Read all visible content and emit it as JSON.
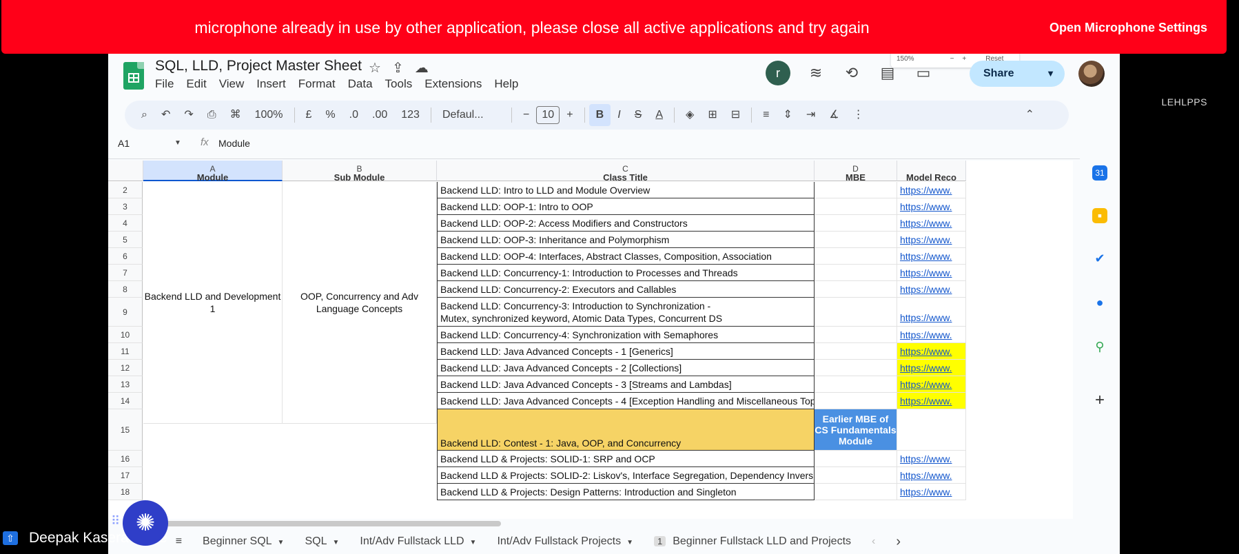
{
  "alert": {
    "message": "microphone already in use by other application, please close all active applications and try again",
    "action": "Open Microphone Settings"
  },
  "right_label": "LEHLPPS",
  "doc": {
    "title": "SQL, LLD, Project Master Sheet",
    "menu": [
      "File",
      "Edit",
      "View",
      "Insert",
      "Format",
      "Data",
      "Tools",
      "Extensions",
      "Help"
    ],
    "share": "Share",
    "user_initial": "r"
  },
  "zoom_popup": {
    "level": "150%",
    "minus": "−",
    "plus": "+",
    "reset": "Reset"
  },
  "toolbar": {
    "zoom": "100%",
    "currency": "£",
    "percent": "%",
    "dec_less": ".0",
    "dec_more": ".00",
    "format_123": "123",
    "font": "Defaul...",
    "minus": "−",
    "font_size": "10",
    "plus": "+",
    "bold": "B",
    "italic": "I",
    "strike": "S",
    "text_color": "A"
  },
  "formula_bar": {
    "cell_ref": "A1",
    "fx": "fx",
    "value": "Module"
  },
  "columns": [
    {
      "letter": "A",
      "header_peek": "Module"
    },
    {
      "letter": "B",
      "header_peek": "Sub Module"
    },
    {
      "letter": "C",
      "header_peek": "Class Title"
    },
    {
      "letter": "D",
      "header_peek": "MBE"
    },
    {
      "letter": "",
      "header_peek": "Model Reco"
    }
  ],
  "rows": [
    {
      "num": "2",
      "title": "Backend LLD: Intro to LLD and Module Overview",
      "link": "https://www."
    },
    {
      "num": "3",
      "title": "Backend LLD: OOP-1: Intro to OOP",
      "link": "https://www."
    },
    {
      "num": "4",
      "title": "Backend LLD: OOP-2: Access Modifiers and Constructors",
      "link": "https://www."
    },
    {
      "num": "5",
      "title": "Backend LLD: OOP-3: Inheritance and Polymorphism",
      "link": "https://www."
    },
    {
      "num": "6",
      "title": "Backend LLD: OOP-4: Interfaces, Abstract Classes, Composition, Association",
      "link": "https://www."
    },
    {
      "num": "7",
      "title": "Backend LLD: Concurrency-1: Introduction to Processes and Threads",
      "link": "https://www."
    },
    {
      "num": "8",
      "title": "Backend LLD: Concurrency-2: Executors and Callables",
      "link": "https://www."
    },
    {
      "num": "9",
      "title": "Backend LLD: Concurrency-3: Introduction to Synchronization -",
      "title2": "Mutex, synchronized keyword, Atomic Data Types, Concurrent DS",
      "link": "https://www."
    },
    {
      "num": "10",
      "title": "Backend LLD: Concurrency-4: Synchronization with Semaphores",
      "link": "https://www."
    },
    {
      "num": "11",
      "title": "Backend LLD: Java Advanced Concepts - 1 [Generics]",
      "link": "https://www."
    },
    {
      "num": "12",
      "title": "Backend LLD: Java Advanced Concepts - 2 [Collections]",
      "link": "https://www."
    },
    {
      "num": "13",
      "title": "Backend LLD: Java Advanced Concepts - 3 [Streams and Lambdas]",
      "link": "https://www."
    },
    {
      "num": "14",
      "title": "Backend LLD: Java Advanced Concepts - 4 [Exception Handling and Miscellaneous Topics]",
      "link": "https://www."
    },
    {
      "num": "15",
      "title": "Backend LLD: Contest - 1: Java, OOP, and Concurrency",
      "mbe": "Earlier MBE of CS Fundamentals Module",
      "link": ""
    },
    {
      "num": "16",
      "title": "Backend LLD & Projects: SOLID-1: SRP and OCP",
      "link": "https://www."
    },
    {
      "num": "17",
      "title": "Backend LLD & Projects: SOLID-2: Liskov's, Interface Segregation, Dependency Inversion",
      "link": "https://www."
    },
    {
      "num": "18",
      "title": "Backend LLD & Projects: Design Patterns: Introduction and Singleton",
      "link": "https://www."
    }
  ],
  "merged": {
    "module": "Backend LLD and Development 1",
    "sub_module": "OOP, Concurrency and Adv Language Concepts"
  },
  "sheet_tabs": [
    {
      "label": "Beginner SQL"
    },
    {
      "label": "SQL"
    },
    {
      "label": "Int/Adv Fullstack LLD"
    },
    {
      "label": "Int/Adv Fullstack Projects"
    },
    {
      "label": "Beginner Fullstack LLD and Projects",
      "badge": "1"
    }
  ],
  "presenter": "Deepak Kasera (Scre",
  "colors": {
    "alert": "#ff0018",
    "highlight": "#ffff00",
    "contest": "#f6d365",
    "mbe": "#4a90e2",
    "link": "#1155cc"
  }
}
